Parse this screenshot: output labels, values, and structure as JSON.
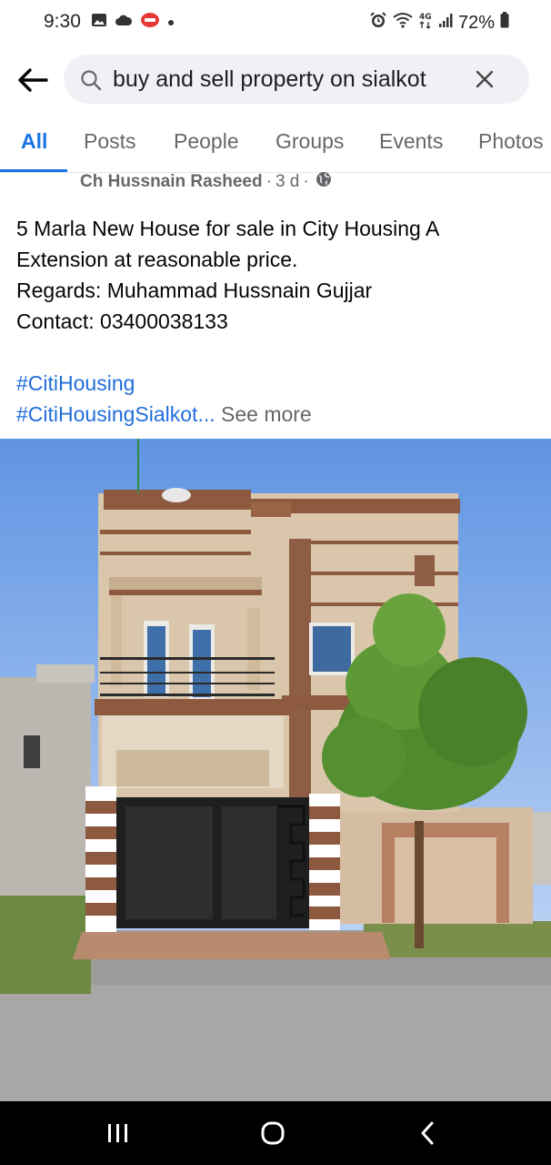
{
  "status_bar": {
    "time": "9:30",
    "icons_left": [
      "gallery-icon",
      "cloud-icon",
      "app-badge-icon",
      "dot-icon"
    ],
    "icons_right": [
      "alarm-icon",
      "wifi-icon",
      "4g-icon",
      "signal-icon"
    ],
    "battery": "72%"
  },
  "search": {
    "query": "buy and sell property on sialkot"
  },
  "tabs": [
    {
      "label": "All",
      "active": true
    },
    {
      "label": "Posts",
      "active": false
    },
    {
      "label": "People",
      "active": false
    },
    {
      "label": "Groups",
      "active": false
    },
    {
      "label": "Events",
      "active": false
    },
    {
      "label": "Photos",
      "active": false
    }
  ],
  "post": {
    "author": "Ch Hussnain Rasheed",
    "time": "3 d",
    "separator": "·",
    "lines": [
      "5 Marla New House for sale in City Housing A",
      "Extension at reasonable price.",
      "Regards: Muhammad Hussnain Gujjar",
      "Contact: 03400038133"
    ],
    "hashtags": [
      "#CitiHousing",
      "#CitiHousingSialkot"
    ],
    "ellipsis": "...",
    "see_more": "See more"
  },
  "colors": {
    "accent": "#1b74e4",
    "hashtag": "#216fdb",
    "muted": "#65676b",
    "search_bg": "#eff1f4",
    "nav_bg": "#000000"
  }
}
